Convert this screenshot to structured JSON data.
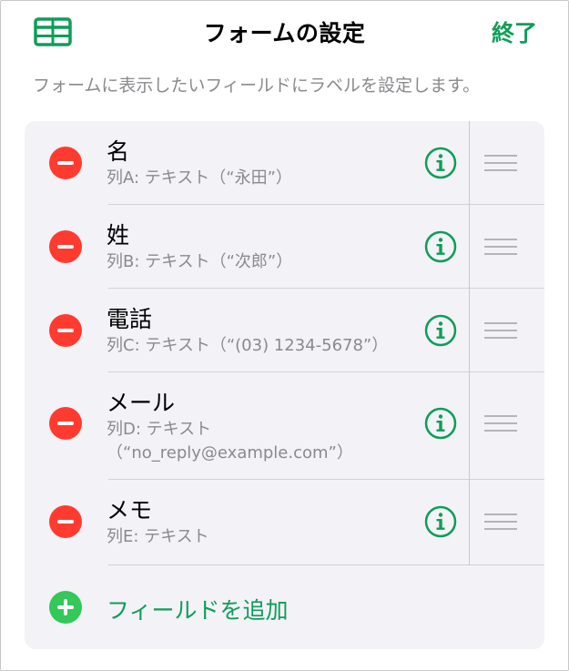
{
  "nav": {
    "title": "フォームの設定",
    "done_label": "終了",
    "left_icon": "table-icon"
  },
  "hint": "フォームに表示したいフィールドにラベルを設定します。",
  "fields": [
    {
      "title": "名",
      "sub_lines": [
        "列A: テキスト（“永田”）"
      ]
    },
    {
      "title": "姓",
      "sub_lines": [
        "列B: テキスト（“次郎”）"
      ]
    },
    {
      "title": "電話",
      "sub_lines": [
        "列C: テキスト（“(03) 1234-5678”）"
      ]
    },
    {
      "title": "メール",
      "sub_lines": [
        "列D: テキスト",
        "（“no_reply@example.com”）"
      ]
    },
    {
      "title": "メモ",
      "sub_lines": [
        "列E: テキスト"
      ]
    }
  ],
  "add_field_label": "フィールドを追加",
  "colors": {
    "accent": "#0f9d58",
    "remove": "#ff3b30",
    "add": "#34c759",
    "card_bg": "#f2f2f7",
    "secondary_text": "#8a8a8e"
  },
  "icons": {
    "remove": "minus-circle-icon",
    "info": "info-circle-icon",
    "reorder": "drag-handle-icon",
    "add": "plus-circle-icon"
  }
}
